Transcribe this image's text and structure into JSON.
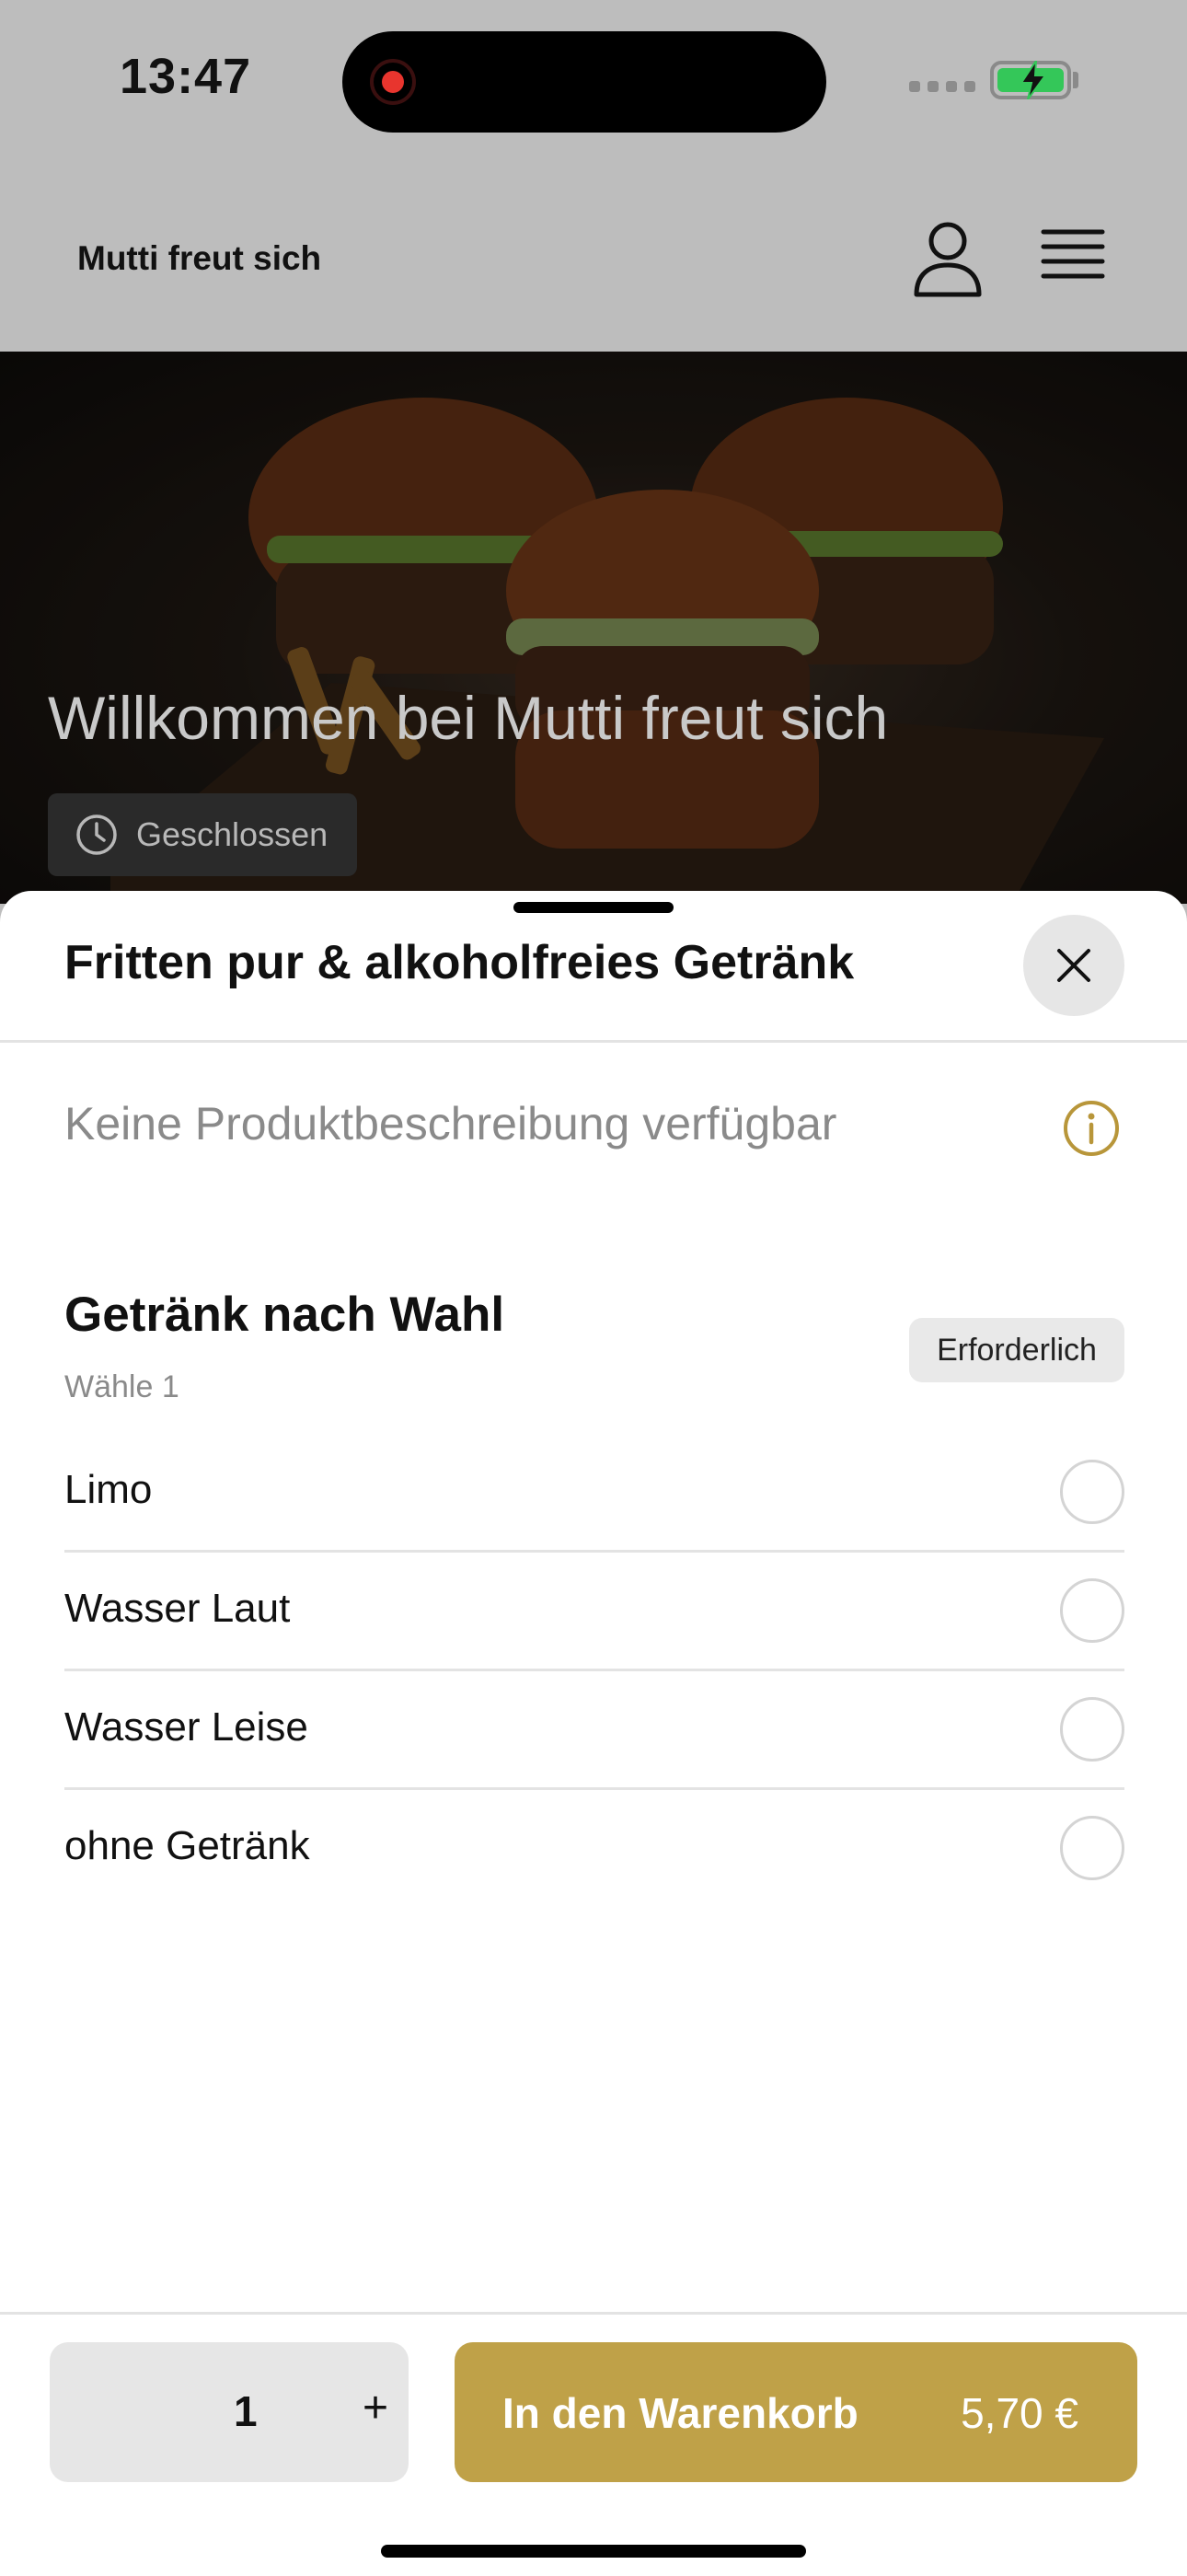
{
  "status_bar": {
    "time": "13:47"
  },
  "header": {
    "brand": "Mutti freut sich"
  },
  "hero": {
    "title": "Willkommen bei Mutti freut sich",
    "hours_status": "Geschlossen"
  },
  "product_sheet": {
    "title": "Fritten pur & alkoholfreies Getränk",
    "description": "Keine Produktbeschreibung verfügbar",
    "option_group": {
      "title": "Getränk nach Wahl",
      "subtitle": "Wähle 1",
      "badge": "Erforderlich",
      "options": [
        {
          "label": "Limo",
          "selected": false
        },
        {
          "label": "Wasser Laut",
          "selected": false
        },
        {
          "label": "Wasser Leise",
          "selected": false
        },
        {
          "label": "ohne Getränk",
          "selected": false
        }
      ]
    }
  },
  "footer": {
    "quantity": "1",
    "plus": "+",
    "add_to_cart": "In den Warenkorb",
    "price": "5,70 €"
  },
  "colors": {
    "accent": "#bfa148",
    "info_icon": "#b8963a",
    "battery": "#34c759",
    "recording": "#e8352e"
  },
  "icons": [
    "record-icon",
    "signal-icon",
    "battery-charging-icon",
    "user-icon",
    "menu-icon",
    "clock-icon",
    "close-icon",
    "info-icon"
  ]
}
